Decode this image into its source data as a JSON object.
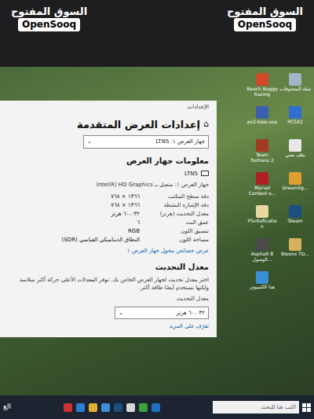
{
  "watermarks": [
    {
      "arabic": "السوق المفتوح",
      "latin": "OpenSooq"
    },
    {
      "arabic": "السوق المفتوح",
      "latin": "OpenSooq"
    }
  ],
  "window": {
    "title": "الإعدادات",
    "home_glyph": "⌂",
    "heading": "إعدادات العرض المتقدمة",
    "display_select": "جهاز العرض ١: LTN5",
    "caret": "⌄"
  },
  "display_info": {
    "heading": "معلومات جهاز العرض",
    "name": "LTN5",
    "adapter": "جهاز العرض ١: متصل بـ Intel(R) HD Graphics",
    "rows": [
      {
        "label": "دقة سطح المكتب",
        "value": "١٣٦٦ × ٧٦٨"
      },
      {
        "label": "دقة الإشارة النشطة",
        "value": "١٣٦٦ × ٧٦٨"
      },
      {
        "label": "معدل التحديث (هرتز)",
        "value": "٦٠.٠٣٢ هرتز"
      },
      {
        "label": "عمق البت",
        "value": "٦"
      },
      {
        "label": "تنسيق اللون",
        "value": "RGB"
      },
      {
        "label": "مساحة اللون",
        "value": "النطاق الديناميكي القياسي (SDR)"
      }
    ],
    "link": "عرض خصائص محول جهاز العرض ١"
  },
  "refresh_rate": {
    "heading": "معدل التحديث",
    "description": "اختر معدل تحديث لجهاز العرض الخاص بك. توفر المعدلات الأعلى حركة أكثر سلاسة ولكنها تستخدم أيضًا طاقة أكثر.",
    "label": "معدل التحديث",
    "value": "٦٠.٠٣٢ هرتز",
    "link": "تعرّف على المزيد"
  },
  "desktop_icons": [
    {
      "label": "Beach Buggy Racing",
      "color": "#d04a2a"
    },
    {
      "label": "سلة المحذوفات",
      "color": "#9fb6c8"
    },
    {
      "label": "ps2-bios-usa",
      "color": "#3a5fb0"
    },
    {
      "label": "PCSX2",
      "color": "#2f6fd0"
    },
    {
      "label": "Team Fortress 2",
      "color": "#a33a22"
    },
    {
      "label": "ملف نصي",
      "color": "#e8e8e8"
    },
    {
      "label": "Marvel Contest o...",
      "color": "#b02020"
    },
    {
      "label": "Dreamlig...",
      "color": "#e0a030"
    },
    {
      "label": "PSvitafication",
      "color": "#e8d8a0"
    },
    {
      "label": "Steam",
      "color": "#1b4f80"
    },
    {
      "label": "Asphalt 8 الوصول...",
      "color": "#4a4a4a"
    },
    {
      "label": "Bloons TD...",
      "color": "#d8b060"
    },
    {
      "label": "هذا الكمبيوتر",
      "color": "#3b8fd8"
    }
  ],
  "taskbar": {
    "search_placeholder": "اكتب هنا للبحث",
    "corner_text": "الع",
    "apps": [
      {
        "color": "#d03030"
      },
      {
        "color": "#2f7fd0"
      },
      {
        "color": "#e0b030"
      },
      {
        "color": "#3b8fd8"
      },
      {
        "color": "#1b4f80"
      },
      {
        "color": "#d8d8d8"
      },
      {
        "color": "#40a040"
      },
      {
        "color": "#2070c0"
      }
    ]
  }
}
